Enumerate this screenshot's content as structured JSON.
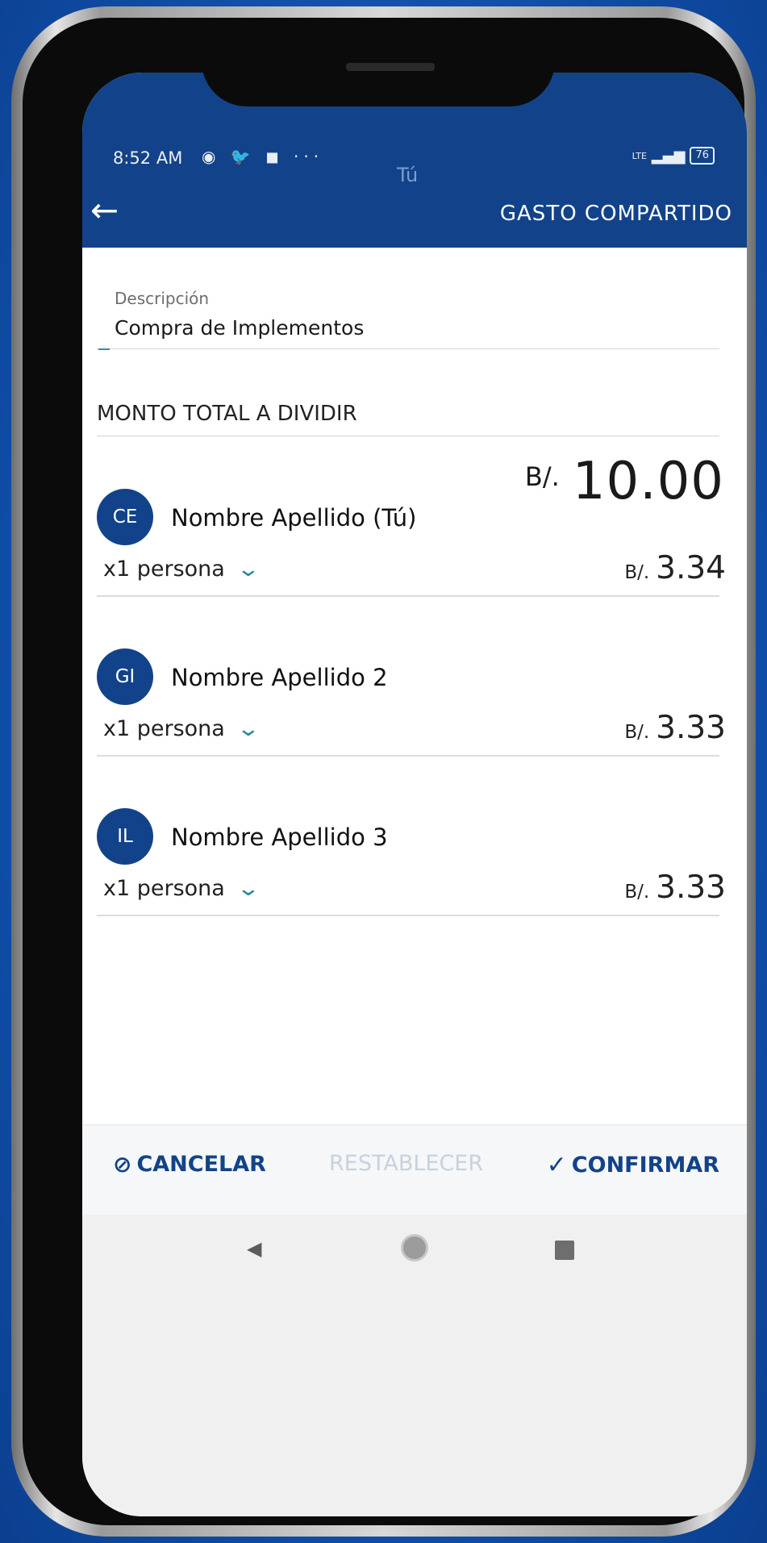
{
  "status_bar": {
    "time": "8:52 AM",
    "left_icons": "◉ 🐦 ◼ ···",
    "network": "LTE",
    "signal": "▂▄▆",
    "battery": "76"
  },
  "app_bar": {
    "hint_text": "Tú",
    "title": "GASTO COMPARTIDO",
    "back_glyph": "←"
  },
  "description": {
    "label": "Descripción",
    "value": "Compra de Implementos"
  },
  "total": {
    "label": "MONTO TOTAL A DIVIDIR",
    "currency": "B/.",
    "amount": "10.00"
  },
  "participants": [
    {
      "initials": "CE",
      "name": "Nombre Apellido (Tú)",
      "count_label": "x1 persona",
      "currency": "B/.",
      "amount": "3.34"
    },
    {
      "initials": "GI",
      "name": "Nombre Apellido 2",
      "count_label": "x1 persona",
      "currency": "B/.",
      "amount": "3.33"
    },
    {
      "initials": "IL",
      "name": "Nombre Apellido 3",
      "count_label": "x1 persona",
      "currency": "B/.",
      "amount": "3.33"
    }
  ],
  "actions": {
    "cancel_icon": "⊘",
    "cancel_label": "CANCELAR",
    "reset_label": "RESTABLECER",
    "confirm_icon": "✓",
    "confirm_label": "CONFIRMAR"
  },
  "nav": {
    "back_glyph": "◀"
  },
  "colors": {
    "primary": "#12438a",
    "accent": "#2a8a9a",
    "disabled": "#c8d2dc"
  }
}
